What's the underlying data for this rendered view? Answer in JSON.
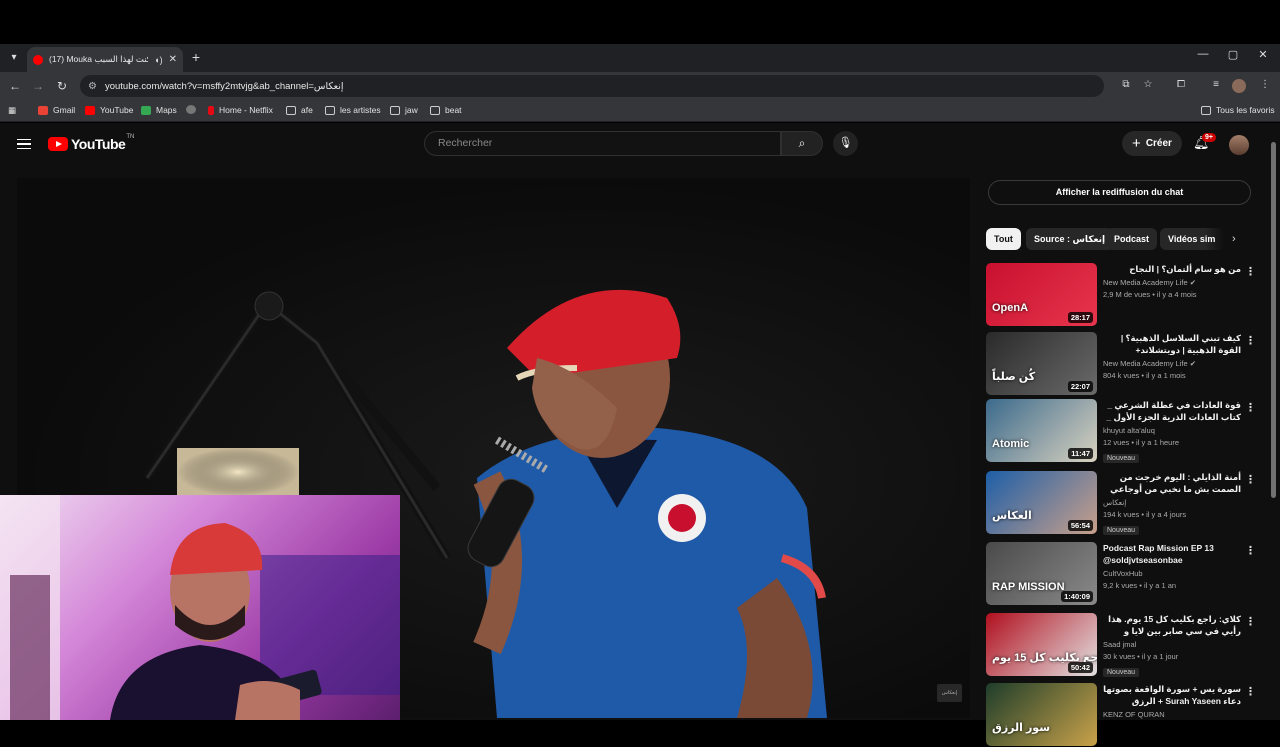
{
  "browser": {
    "tab_title": "(17) Mouka كنت لهذا السبب",
    "url": "youtube.com/watch?v=msffy2mtvjg&ab_channel=إنعكاس",
    "bookmarks": [
      "Gmail",
      "YouTube",
      "Maps",
      "Home - Netflix",
      "afe",
      "les artistes",
      "jaw",
      "beat"
    ],
    "all_bookmarks": "Tous les favoris"
  },
  "youtube": {
    "logo": "YouTube",
    "logo_sup": "TN",
    "search_placeholder": "Rechercher",
    "create_label": "Créer",
    "notif_count": "9+",
    "chat_replay": "Afficher la rediffusion du chat",
    "chips": [
      "Tout",
      "Source : إنعكاس",
      "Podcast",
      "Vidéos sim"
    ],
    "watermark": "إنعكاس"
  },
  "recommendations": [
    {
      "title": "من هو سام ألتمان؟ | النجاح",
      "channel": "New Media Academy Life",
      "verified": true,
      "meta": "2,9 M de vues • il y a 4 mois",
      "duration": "28:17",
      "badge": "",
      "thumb_text": "OpenA",
      "colors": [
        "#c8102e",
        "#e8364d"
      ]
    },
    {
      "title": "كيف تبني السلاسل الذهبية؟ | القوة الذهبية | دويتشلاند+",
      "channel": "New Media Academy Life",
      "verified": true,
      "meta": "804 k vues • il y a 1 mois",
      "duration": "22:07",
      "badge": "",
      "thumb_text": "كُن صلباً",
      "colors": [
        "#2a2a2a",
        "#6a6a6a"
      ]
    },
    {
      "title": "قوة العادات في عطلة الشرعي _ كتاب العادات الذرية الجزء الأول _ جيمس كلير",
      "channel": "khuyut alta'aluq",
      "verified": false,
      "meta": "12 vues • il y a 1 heure",
      "duration": "11:47",
      "badge": "Nouveau",
      "thumb_text": "Atomic",
      "colors": [
        "#3b6a8c",
        "#d9d2c0"
      ]
    },
    {
      "title": "أمنة الذايلي : اليوم خرجت من الصمت بش ما نخبي من أوجاعي",
      "channel": "إنعكاس",
      "verified": false,
      "meta": "194 k vues • il y a 4 jours",
      "duration": "56:54",
      "badge": "Nouveau",
      "thumb_text": "العكاس",
      "colors": [
        "#1d5ea8",
        "#c9a08a"
      ]
    },
    {
      "title": "Podcast Rap Mission EP 13 @soldjvtseasonbae",
      "channel": "CultVoxHub",
      "verified": false,
      "meta": "9,2 k vues • il y a 1 an",
      "duration": "1:40:09",
      "badge": "",
      "thumb_text": "RAP MISSION",
      "colors": [
        "#4a4a4a",
        "#8a8a8a"
      ]
    },
    {
      "title": "كلاي: راجع بكليب كل 15 يوم. هذا رأيي في سي صابر بين لايا و بوسعادة و حلاني رسالي",
      "channel": "Saad jmal",
      "verified": false,
      "meta": "30 k vues • il y a 1 jour",
      "duration": "50:42",
      "badge": "Nouveau",
      "thumb_text": "راجع بكليب كل 15 يوم!",
      "colors": [
        "#b10f1e",
        "#e2e2e2"
      ]
    },
    {
      "title": "سورة يس + سورة الواقعة بصوتها دعاء Surah Yaseen + الرزق السريع بإذن الله",
      "channel": "KENZ OF QURAN",
      "verified": false,
      "meta": "",
      "duration": "",
      "badge": "",
      "thumb_text": "سور الرزق",
      "colors": [
        "#1e3d2a",
        "#c9a24a"
      ]
    }
  ]
}
